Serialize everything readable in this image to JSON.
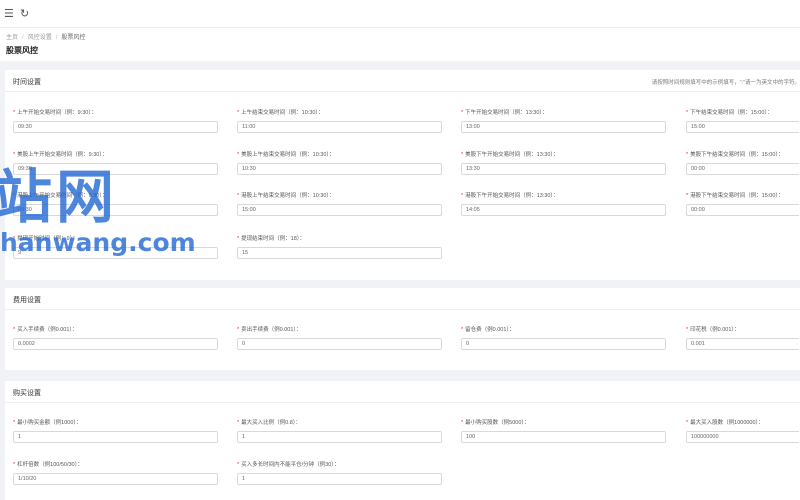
{
  "topbar": {
    "menu_icon": "menu-fold-icon",
    "refresh_icon": "refresh-icon"
  },
  "breadcrumb": [
    "主页",
    "风控设置",
    "股票风控"
  ],
  "page_title": "股票风控",
  "sections": {
    "time": {
      "title": "时间设置",
      "note": "请按照时间规则填写中的示例填写，“:”请一为英文中的字符。",
      "fields": [
        {
          "label": "上午开始交易时间（例：9:30）：",
          "value": "09:30"
        },
        {
          "label": "上午结束交易时间（例：10:30）：",
          "value": "11:00"
        },
        {
          "label": "下午开始交易时间（例：13:30）：",
          "value": "13:00"
        },
        {
          "label": "下午结束交易时间（例：15:00）：",
          "value": "15:00"
        },
        {
          "label": "美股上午开始交易时间（例：9:30）：",
          "value": "09:30"
        },
        {
          "label": "美股上午结束交易时间（例：10:30）：",
          "value": "10:30"
        },
        {
          "label": "美股下午开始交易时间（例：13:30）：",
          "value": "13:30"
        },
        {
          "label": "美股下午结束交易时间（例：15:00）：",
          "value": "00:00"
        },
        {
          "label": "港股上午开始交易时间（例：9:30）：",
          "value": "09:30"
        },
        {
          "label": "港股上午结束交易时间（例：10:30）：",
          "value": "15:00"
        },
        {
          "label": "港股下午开始交易时间（例：13:30）：",
          "value": "14:05"
        },
        {
          "label": "港股下午结束交易时间（例：15:00）：",
          "value": "00:00"
        },
        {
          "label": "提现开始时间（例：9）：",
          "value": "9"
        },
        {
          "label": "提现结束时间（例：18）：",
          "value": "15"
        }
      ]
    },
    "fee": {
      "title": "费用设置",
      "fields": [
        {
          "label": "买入手续费（例0.001）：",
          "value": "0.0002"
        },
        {
          "label": "卖出手续费（例0.001）：",
          "value": "0"
        },
        {
          "label": "留仓费（例0.001）：",
          "value": "0"
        },
        {
          "label": "印花税（例0.001）：",
          "value": "0.001"
        }
      ]
    },
    "buy": {
      "title": "购买设置",
      "fields": [
        {
          "label": "最小购买金额（例1000）：",
          "value": "1"
        },
        {
          "label": "最大买入比例（例0.8）：",
          "value": "1"
        },
        {
          "label": "最小购买股数（例5000）：",
          "value": "100"
        },
        {
          "label": "最大买入股数（例1000000）：",
          "value": "100000000"
        },
        {
          "label": "杠杆倍数（例100/50/30）：",
          "value": "1/10/20"
        },
        {
          "label": "买入多长时间内不能平仓/分钟（例30）：",
          "value": "1"
        }
      ]
    }
  },
  "watermark": {
    "line1": "站网",
    "line2": "hanwang.com"
  }
}
